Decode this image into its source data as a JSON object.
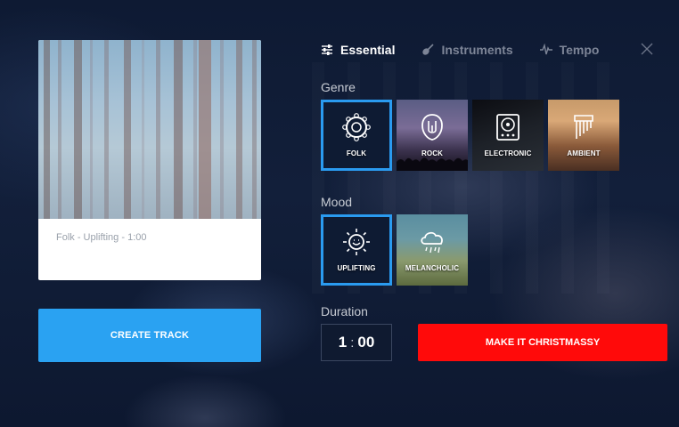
{
  "card": {
    "caption": "Folk - Uplifting - 1:00"
  },
  "create_button": {
    "label": "CREATE TRACK"
  },
  "tabs": [
    {
      "label": "Essential",
      "icon": "sliders-icon",
      "active": true
    },
    {
      "label": "Instruments",
      "icon": "guitar-icon",
      "active": false
    },
    {
      "label": "Tempo",
      "icon": "pulse-icon",
      "active": false
    }
  ],
  "genre": {
    "label": "Genre",
    "selected": "FOLK",
    "options": [
      {
        "label": "FOLK",
        "icon": "tambourine-icon"
      },
      {
        "label": "ROCK",
        "icon": "rock-hand-icon"
      },
      {
        "label": "ELECTRONIC",
        "icon": "turntable-icon"
      },
      {
        "label": "AMBIENT",
        "icon": "pan-flute-icon"
      }
    ]
  },
  "mood": {
    "label": "Mood",
    "selected": "UPLIFTING",
    "options": [
      {
        "label": "UPLIFTING",
        "icon": "smiling-sun-icon"
      },
      {
        "label": "MELANCHOLIC",
        "icon": "rain-cloud-icon"
      }
    ]
  },
  "duration": {
    "label": "Duration",
    "minutes": "1",
    "separator": ":",
    "seconds": "00"
  },
  "christmas_button": {
    "label": "MAKE IT CHRISTMASSY"
  },
  "colors": {
    "accent_blue": "#2aa2f2",
    "accent_red": "#ff0a0a",
    "background": "#0c1830"
  }
}
